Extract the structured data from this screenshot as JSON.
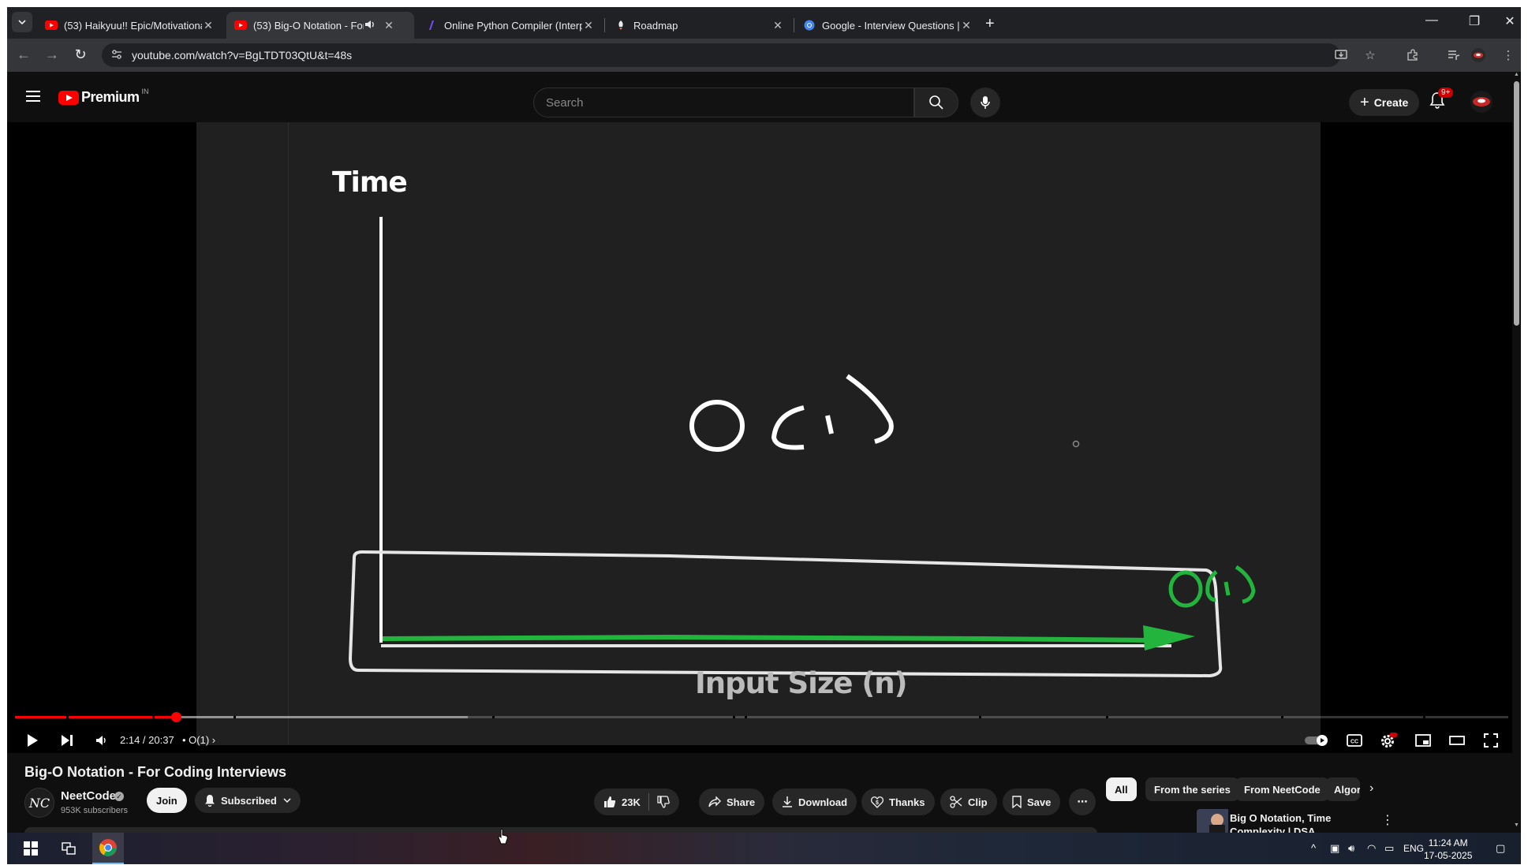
{
  "browser": {
    "tabs": [
      {
        "title": "(53) Haikyuu!! Epic/Motivational",
        "icon": "youtube-icon"
      },
      {
        "title": "(53) Big-O Notation - For Coding Interviews",
        "icon": "youtube-icon",
        "active": true
      },
      {
        "title": "Online Python Compiler (Interpreter)",
        "icon": "compiler-icon"
      },
      {
        "title": "Roadmap",
        "icon": "roadmap-icon"
      },
      {
        "title": "Google - Interview Questions | ",
        "icon": "chrome-icon"
      }
    ],
    "url": "youtube.com/watch?v=BgLTDT03QtU&t=48s"
  },
  "masthead": {
    "logo_text": "Premium",
    "country_code": "IN",
    "search_placeholder": "Search",
    "create_label": "Create",
    "notification_badge": "9+"
  },
  "video": {
    "slide_y_label": "Time",
    "slide_x_label": "Input Size (n)",
    "slide_big_text": "O(1)",
    "slide_small_text": "O(1)",
    "current_time": "2:14",
    "duration": "20:37",
    "time_display": "2:14 / 20:37",
    "chapter": "O(1)",
    "progress_played": 0.108,
    "progress_buffered": 0.303
  },
  "details": {
    "title": "Big-O Notation - For Coding Interviews",
    "channel_name": "NeetCode",
    "channel_avatar_text": "NC",
    "subscribers": "953K subscribers",
    "join_label": "Join",
    "subscribed_label": "Subscribed",
    "likes": "23K",
    "share_label": "Share",
    "download_label": "Download",
    "thanks_label": "Thanks",
    "clip_label": "Clip",
    "save_label": "Save"
  },
  "sidebar": {
    "chips": [
      "All",
      "From the series",
      "From NeetCode",
      "Algorithms"
    ],
    "related_title": "Big O Notation, Time Complexity | DSA"
  },
  "taskbar": {
    "language": "ENG",
    "time": "11:24 AM",
    "date": "17-05-2025"
  },
  "colors": {
    "brand_red": "#ff0000",
    "drawing_green": "#22b43c",
    "background": "#0f0f0f"
  }
}
